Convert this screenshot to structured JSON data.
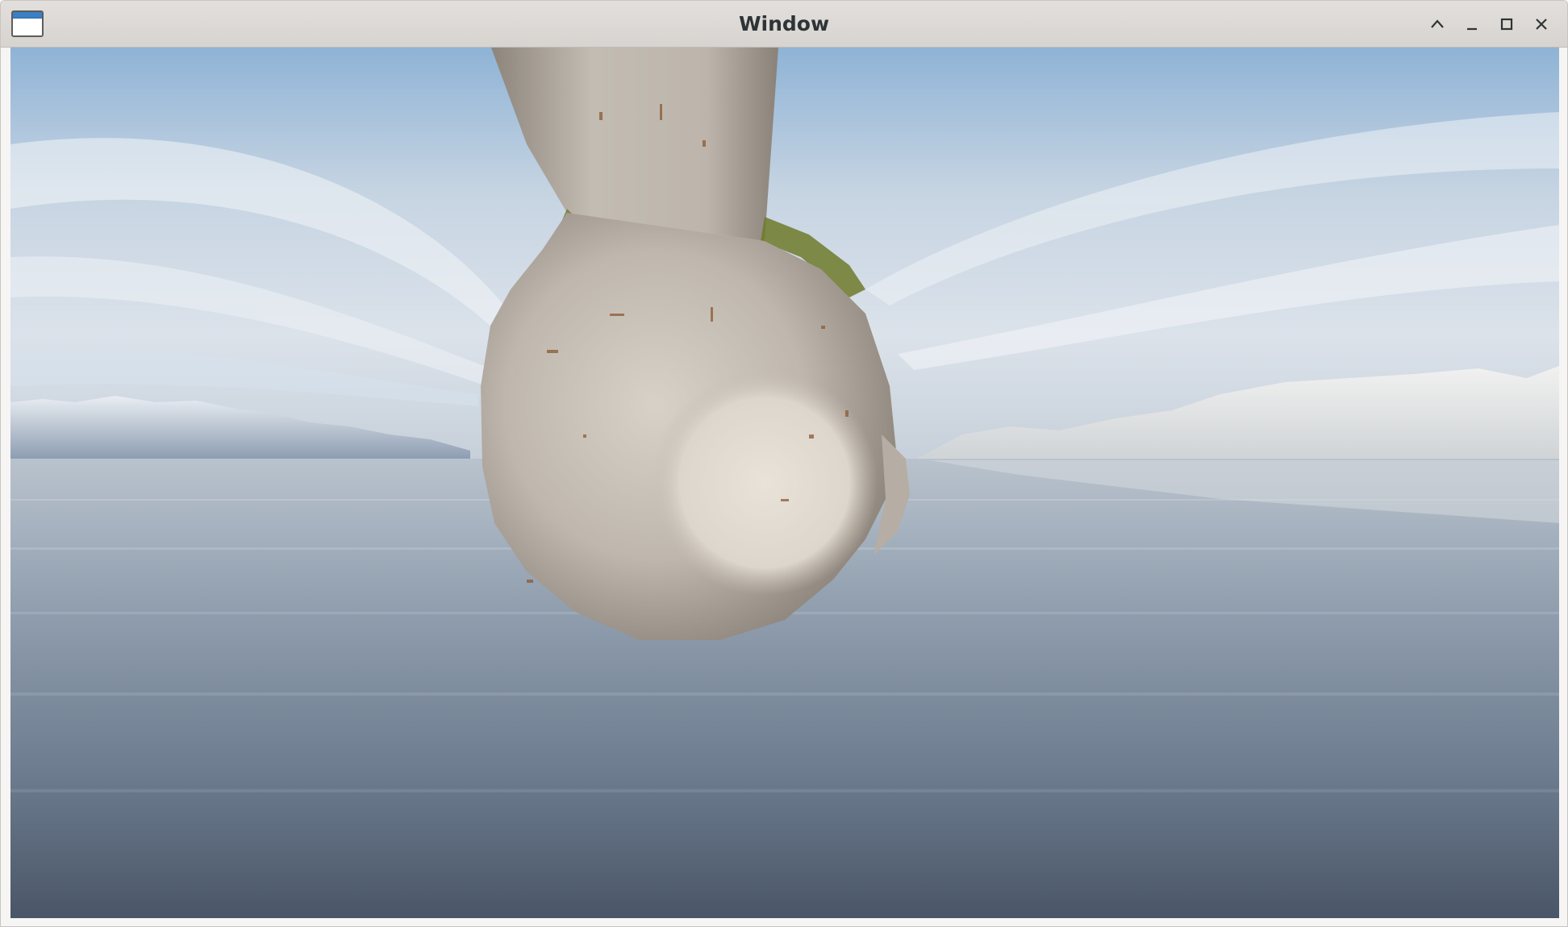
{
  "window": {
    "title": "Window"
  },
  "titlebar_buttons": [
    {
      "name": "shade-button",
      "icon": "chevron-up-icon"
    },
    {
      "name": "minimize-button",
      "icon": "minimize-icon"
    },
    {
      "name": "maximize-button",
      "icon": "maximize-icon"
    },
    {
      "name": "close-button",
      "icon": "close-icon"
    }
  ],
  "scene": {
    "sky_colors": [
      "#7fa7cc",
      "#dfe6ee",
      "#c9d3de"
    ],
    "water_colors": [
      "#b9c4cf",
      "#7e8d9f",
      "#4f5c6e"
    ],
    "object_color": "#cfc8be",
    "moss_color": "#6f7a2a"
  }
}
